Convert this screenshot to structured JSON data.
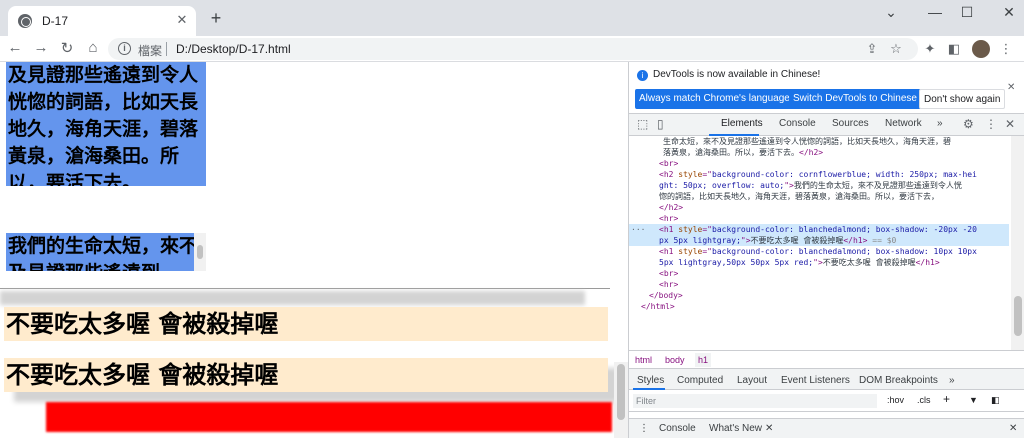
{
  "tab": {
    "title": "D-17",
    "close": "✕",
    "new_tab": "+"
  },
  "window": {
    "minimize": "⌄",
    "minimize2": "—",
    "maximize": "☐",
    "close": "✕"
  },
  "toolbar": {
    "back": "←",
    "forward": "→",
    "reload": "↻",
    "home": "⌂",
    "info": "i",
    "scheme_label": "檔案",
    "url": "D:/Desktop/D-17.html"
  },
  "page": {
    "h2a_text": "及見證那些遙遠到令人恍惚的詞語，比如天長地久，海角天涯，碧落黃泉，滄海桑田。所以，要活下去。",
    "h2b_text": "我們的生命太短，來不及見證那些遙遠到",
    "h1a_text": "不要吃太多喔 會被殺掉喔",
    "h1b_text": "不要吃太多喔 會被殺掉喔"
  },
  "devtools": {
    "notice": {
      "text": "DevTools is now available in Chinese!",
      "btn_match": "Always match Chrome's language",
      "btn_switch": "Switch DevTools to Chinese",
      "btn_dismiss": "Don't show again",
      "close": "✕"
    },
    "tabs": [
      "Elements",
      "Console",
      "Sources",
      "Network",
      "»"
    ],
    "code_lines": [
      {
        "parts": [
          [
            "tx",
            "生命太短，來不及見證那些遙遠到令人恍惚的詞語，比如天長地久，海角天涯，碧"
          ]
        ]
      },
      {
        "parts": [
          [
            "tx",
            "落黃泉，滄海桑田。所以，要活下去。"
          ],
          [
            "tg",
            "</h2>"
          ]
        ]
      },
      {
        "parts": [
          [
            "tg",
            "<br>"
          ]
        ]
      },
      {
        "parts": [
          [
            "tg",
            "<h2 "
          ],
          [
            "an",
            "style"
          ],
          [
            "tg",
            "=\""
          ],
          [
            "av",
            "background-color: cornflowerblue; width: 250px; max-hei"
          ]
        ]
      },
      {
        "parts": [
          [
            "av",
            "ght: 50px; overflow: auto;"
          ],
          [
            "tg",
            "\">"
          ],
          [
            "tx",
            "我們的生命太短，來不及見證那些遙遠到令人恍"
          ]
        ]
      },
      {
        "parts": [
          [
            "tx",
            "惚的詞語，比如天長地久，海角天涯，碧落黃泉，滄海桑田。所以，要活下去，"
          ]
        ]
      },
      {
        "parts": [
          [
            "tg",
            "</h2>"
          ]
        ]
      },
      {
        "parts": [
          [
            "tg",
            "<hr>"
          ]
        ]
      },
      {
        "sel": true,
        "parts": [
          [
            "tg",
            "<h1 "
          ],
          [
            "an",
            "style"
          ],
          [
            "tg",
            "=\""
          ],
          [
            "av",
            "background-color: blanchedalmond; box-shadow: -20px -20"
          ]
        ]
      },
      {
        "sel": true,
        "parts": [
          [
            "av",
            "px 5px lightgray;"
          ],
          [
            "tg",
            "\">"
          ],
          [
            "tx",
            "不要吃太多喔 會被殺掉喔"
          ],
          [
            "tg",
            "</h1>"
          ],
          [
            "cm",
            " == $0"
          ]
        ]
      },
      {
        "parts": [
          [
            "tg",
            "<h1 "
          ],
          [
            "an",
            "style"
          ],
          [
            "tg",
            "=\""
          ],
          [
            "av",
            "background-color: blanchedalmond; box-shadow: 10px 10px"
          ]
        ]
      },
      {
        "parts": [
          [
            "av",
            "5px lightgray,50px 50px 5px red;"
          ],
          [
            "tg",
            "\">"
          ],
          [
            "tx",
            "不要吃太多喔 會被殺掉喔"
          ],
          [
            "tg",
            "</h1>"
          ]
        ]
      },
      {
        "parts": [
          [
            "tg",
            "<br>"
          ]
        ]
      },
      {
        "parts": [
          [
            "tg",
            "<hr>"
          ]
        ]
      },
      {
        "parts": [
          [
            "tg",
            "</body>"
          ]
        ]
      },
      {
        "parts": [
          [
            "tg",
            "</html>"
          ]
        ]
      }
    ],
    "breadcrumbs": [
      "html",
      "body",
      "h1"
    ],
    "styles_tabs": [
      "Styles",
      "Computed",
      "Layout",
      "Event Listeners",
      "DOM Breakpoints",
      "»"
    ],
    "filter_placeholder": "Filter",
    "filter_hov": ":hov",
    "filter_cls": ".cls",
    "filter_plus": "+",
    "drawer_tabs": [
      "Console",
      "What's New"
    ],
    "drawer_close": "✕"
  }
}
